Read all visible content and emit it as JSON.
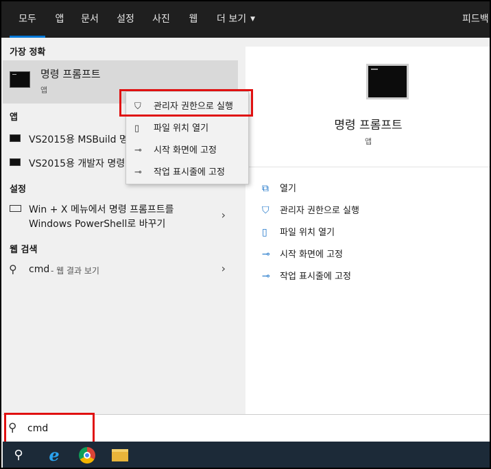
{
  "tabs": [
    {
      "label": "모두",
      "active": true
    },
    {
      "label": "앱"
    },
    {
      "label": "문서"
    },
    {
      "label": "설정"
    },
    {
      "label": "사진"
    },
    {
      "label": "웹"
    },
    {
      "label": "더 보기"
    },
    {
      "label": "피드백"
    }
  ],
  "left": {
    "best_match_header": "가장 정확",
    "best_match": {
      "title": "명령 프롬프트",
      "subtitle": "앱"
    },
    "apps_header": "앱",
    "apps": [
      {
        "label": "VS2015용 MSBuild 명령 프롬프트"
      },
      {
        "label": "VS2015용 개발자 명령 프롬프트"
      }
    ],
    "settings_header": "설정",
    "setting_item": {
      "line1": "Win + X 메뉴에서 명령 프롬프트를",
      "line2": "Windows PowerShell로 바꾸기"
    },
    "web_header": "웹 검색",
    "web_item": {
      "query": "cmd",
      "suffix": " - 웹 결과 보기"
    }
  },
  "context_menu": {
    "items": [
      {
        "label": "관리자 권한으로 실행",
        "icon": "shield-icon",
        "highlighted": true
      },
      {
        "label": "파일 위치 열기",
        "icon": "file-location-icon"
      },
      {
        "label": "시작 화면에 고정",
        "icon": "pin-icon"
      },
      {
        "label": "작업 표시줄에 고정",
        "icon": "pin-icon"
      }
    ]
  },
  "right": {
    "title": "명령 프롬프트",
    "subtitle": "앱",
    "actions": [
      {
        "label": "열기",
        "icon": "open-icon"
      },
      {
        "label": "관리자 권한으로 실행",
        "icon": "shield-icon"
      },
      {
        "label": "파일 위치 열기",
        "icon": "file-location-icon"
      },
      {
        "label": "시작 화면에 고정",
        "icon": "pin-icon"
      },
      {
        "label": "작업 표시줄에 고정",
        "icon": "pin-icon"
      }
    ]
  },
  "search": {
    "value": "cmd",
    "icon": "search-icon"
  },
  "taskbar": {
    "items": [
      {
        "icon": "search-icon"
      },
      {
        "icon": "internet-explorer-icon",
        "active": true
      },
      {
        "icon": "chrome-icon"
      },
      {
        "icon": "file-explorer-icon"
      }
    ]
  },
  "colors": {
    "accent": "#0078d7",
    "highlight_box": "#e01010",
    "tabbar_bg": "#1f1f1f",
    "taskbar_bg": "#1c2a38"
  }
}
